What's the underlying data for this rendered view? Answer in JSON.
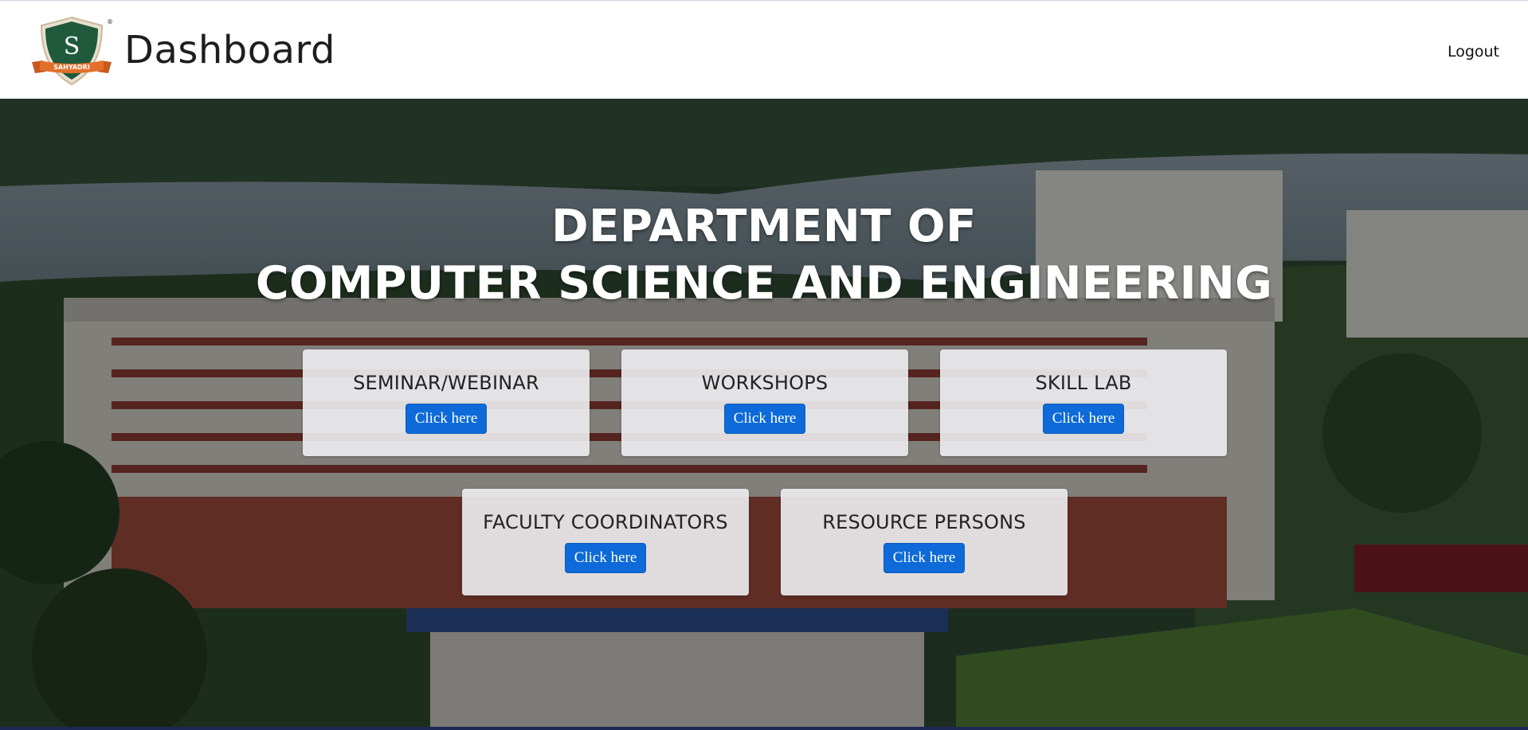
{
  "navbar": {
    "title": "Dashboard",
    "logout_label": "Logout",
    "logo": {
      "letter": "S",
      "ribbon_text": "SAHYADRI",
      "registered_mark": "®"
    }
  },
  "hero": {
    "heading_line1": "DEPARTMENT OF",
    "heading_line2": "COMPUTER SCIENCE AND ENGINEERING"
  },
  "cards": [
    {
      "title": "SEMINAR/WEBINAR",
      "button_label": "Click here"
    },
    {
      "title": "WORKSHOPS",
      "button_label": "Click here"
    },
    {
      "title": "SKILL LAB",
      "button_label": "Click here"
    },
    {
      "title": "FACULTY COORDINATORS",
      "button_label": "Click here"
    },
    {
      "title": "RESOURCE PERSONS",
      "button_label": "Click here"
    }
  ],
  "colors": {
    "button": "#0d6ad8",
    "card": "#ebeced",
    "logo_shield": "#1f5a3c",
    "logo_ribbon": "#e2702a"
  }
}
